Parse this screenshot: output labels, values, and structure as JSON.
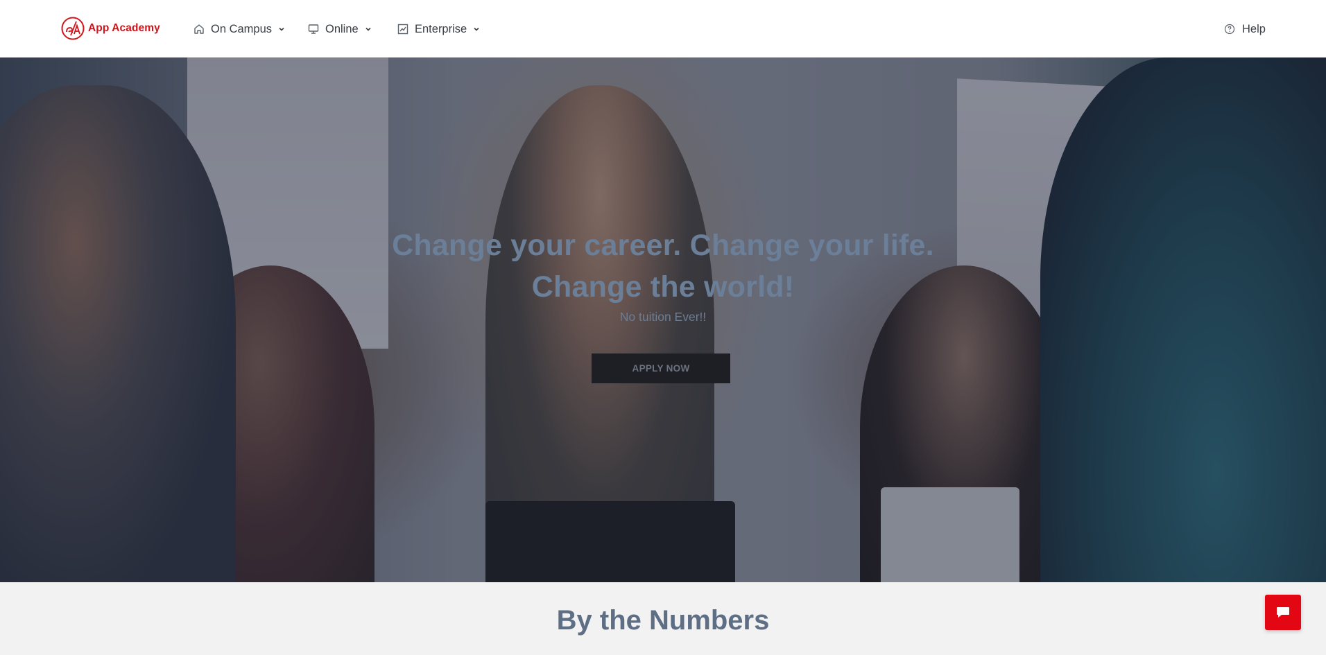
{
  "brand": {
    "name": "App Academy",
    "color": "#d3131a"
  },
  "nav": {
    "items": [
      {
        "label": "On Campus",
        "icon": "home-icon"
      },
      {
        "label": "Online",
        "icon": "monitor-icon"
      },
      {
        "label": "Enterprise",
        "icon": "chart-icon"
      }
    ],
    "help": {
      "label": "Help",
      "icon": "help-circle-icon"
    }
  },
  "hero": {
    "title_line1": "Change your career. Change your life.",
    "title_line2": "Change the world!",
    "subtitle": "No tuition Ever!!",
    "cta_label": "APPLY NOW"
  },
  "numbers": {
    "title": "By the Numbers"
  },
  "chat": {
    "icon": "chat-bubble-icon",
    "color": "#e30613"
  }
}
